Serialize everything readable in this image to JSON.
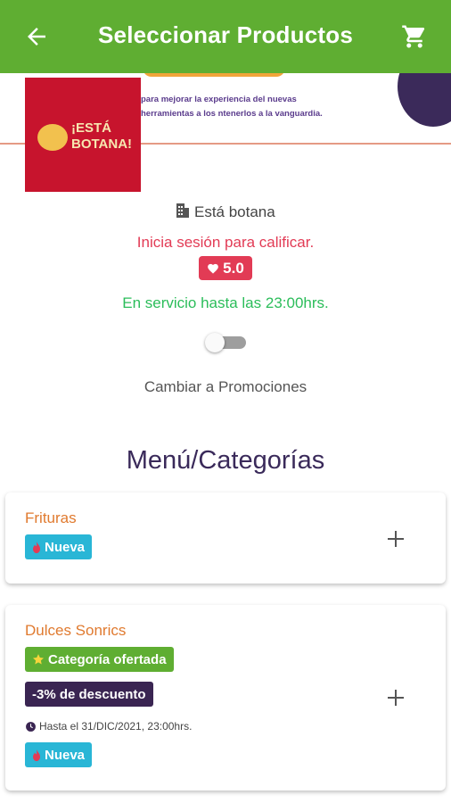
{
  "header": {
    "title": "Seleccionar Productos"
  },
  "banner": {
    "text": "para mejorar la experiencia del nuevas herramientas a los ntenerlos a la vanguardia."
  },
  "logo": {
    "line1": "¡ESTÁ",
    "line2": "BOTANA!"
  },
  "store": {
    "name": "Está botana",
    "login_prompt": "Inicia sesión para calificar.",
    "rating": "5.0",
    "service_hours": "En servicio hasta las 23:00hrs.",
    "toggle_label": "Cambiar a Promociones"
  },
  "menu": {
    "title": "Menú/Categorías",
    "categories": [
      {
        "name": "Frituras",
        "new_badge": "Nueva"
      },
      {
        "name": "Dulces Sonrics",
        "offer_badge": "Categoría ofertada",
        "discount_badge": "-3% de descuento",
        "until": "Hasta el 31/DIC/2021, 23:00hrs.",
        "new_badge": "Nueva"
      }
    ]
  },
  "colors": {
    "header": "#5fae32",
    "accent_red": "#e23b55",
    "service_green": "#2bbd5a",
    "category_orange": "#e07a2f",
    "new_badge": "#29b6d6",
    "discount_badge": "#3a2552"
  }
}
